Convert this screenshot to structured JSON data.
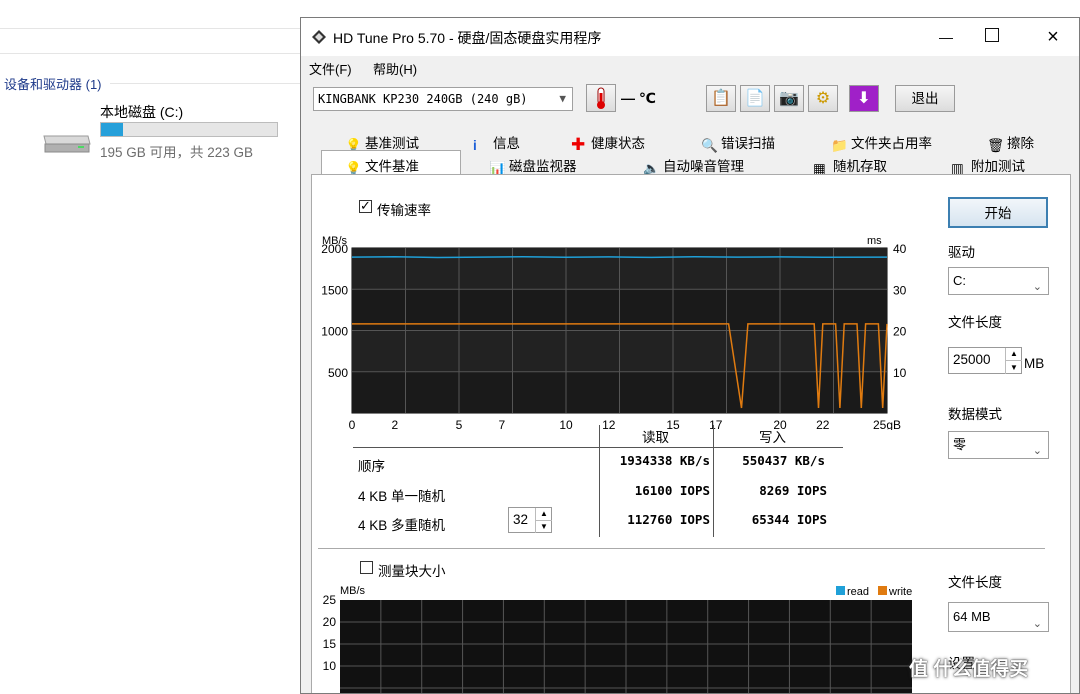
{
  "explorer": {
    "section_title": "设备和驱动器 (1)",
    "drive_name": "本地磁盘 (C:)",
    "drive_usage_fraction": 0.125,
    "drive_free_text": "195 GB 可用，共 223 GB"
  },
  "window": {
    "title": "HD Tune Pro 5.70 - 硬盘/固态硬盘实用程序",
    "menu": [
      "文件(F)",
      "帮助(H)"
    ],
    "drive_select": "KINGBANK KP230 240GB (240 gB)",
    "temperature": "— ℃",
    "exit_label": "退出"
  },
  "tabs": {
    "row1": [
      "基准测试",
      "信息",
      "健康状态",
      "错误扫描",
      "文件夹占用率",
      "擦除"
    ],
    "row2": [
      "文件基准",
      "磁盘监视器",
      "自动噪音管理",
      "随机存取",
      "附加测试"
    ]
  },
  "panel": {
    "transfer_rate_label": "传输速率",
    "block_size_label": "测量块大小",
    "start_label": "开始",
    "drive_label": "驱动",
    "drive_value": "C:",
    "file_length_label": "文件长度",
    "file_length_value": "25000",
    "file_length_unit": "MB",
    "data_mode_label": "数据模式",
    "data_mode_value": "零",
    "file_length2_label": "文件长度",
    "file_length2_value": "64 MB",
    "bottom_label": "设置"
  },
  "results": {
    "header_read": "读取",
    "header_write": "写入",
    "rows": [
      {
        "label": "顺序",
        "read": "1934338 KB/s",
        "write": "550437 KB/s"
      },
      {
        "label": "4 KB 单一随机",
        "read": "16100 IOPS",
        "write": "8269 IOPS"
      },
      {
        "label": "4 KB 多重随机",
        "read": "112760 IOPS",
        "write": "65344 IOPS"
      }
    ],
    "queue_depth": "32"
  },
  "chart_data": [
    {
      "type": "line",
      "ylabel": "MB/s",
      "y2label": "ms",
      "y_ticks": [
        "2000",
        "1500",
        "1000",
        "500"
      ],
      "y2_ticks": [
        "40",
        "30",
        "20",
        "10"
      ],
      "x_ticks": [
        "0",
        "2",
        "5",
        "7",
        "10",
        "12",
        "15",
        "17",
        "20",
        "22",
        "25gB"
      ],
      "xlim": [
        0,
        25
      ],
      "ylim": [
        0,
        2000
      ],
      "series": [
        {
          "color": "#1fa0d8",
          "values": [
            [
              0,
              1890
            ],
            [
              2,
              1895
            ],
            [
              4,
              1885
            ],
            [
              6,
              1890
            ],
            [
              8,
              1895
            ],
            [
              10,
              1888
            ],
            [
              12,
              1892
            ],
            [
              14,
              1886
            ],
            [
              16,
              1893
            ],
            [
              18,
              1890
            ],
            [
              20,
              1892
            ],
            [
              22,
              1887
            ],
            [
              25,
              1890
            ]
          ]
        },
        {
          "color": "#e07b10",
          "values": [
            [
              0,
              1080
            ],
            [
              17.6,
              1080
            ],
            [
              18.2,
              60
            ],
            [
              18.5,
              1080
            ],
            [
              21.6,
              1080
            ],
            [
              21.8,
              60
            ],
            [
              22,
              1080
            ],
            [
              22.6,
              1080
            ],
            [
              22.8,
              60
            ],
            [
              23,
              1080
            ],
            [
              23.6,
              1080
            ],
            [
              23.8,
              60
            ],
            [
              24,
              1080
            ],
            [
              24.6,
              1080
            ],
            [
              24.8,
              60
            ],
            [
              25,
              1080
            ]
          ]
        }
      ]
    },
    {
      "type": "bar",
      "ylabel": "MB/s",
      "y_ticks": [
        "25",
        "20",
        "15",
        "10"
      ],
      "legend": [
        "read",
        "write"
      ],
      "legend_colors": [
        "#1fa0d8",
        "#e07b10"
      ],
      "series": []
    }
  ],
  "watermark": "值 什么值得买"
}
